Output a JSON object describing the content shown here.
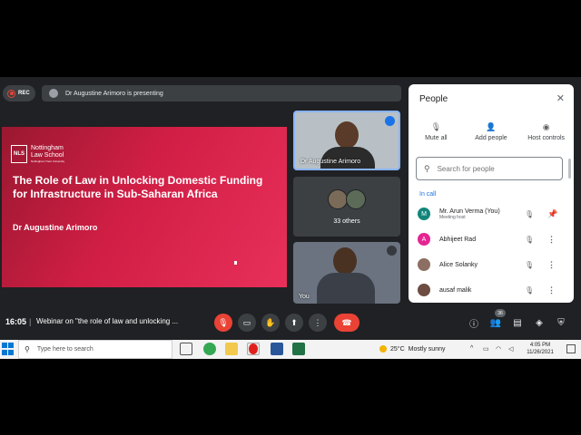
{
  "recording": {
    "label": "REC"
  },
  "presenter_banner": {
    "text": "Dr Augustine Arimoro is presenting"
  },
  "slide": {
    "org_name_line1": "Nottingham",
    "org_name_line2": "Law School",
    "org_sub": "Nottingham Trent University",
    "logo_text": "NLS",
    "title": "The Role of Law in Unlocking  Domestic Funding for Infrastructure in Sub-Saharan Africa",
    "author": "Dr Augustine Arimoro"
  },
  "tiles": {
    "presenter_name": "Dr Augustine Arimoro",
    "others_label": "33 others",
    "self_label": "You"
  },
  "people_panel": {
    "title": "People",
    "actions": [
      {
        "icon": "mic-off-icon",
        "label": "Mute all"
      },
      {
        "icon": "add-person-icon",
        "label": "Add people"
      },
      {
        "icon": "toggle-icon",
        "label": "Host controls"
      }
    ],
    "search_placeholder": "Search for people",
    "section_label": "In call",
    "participants": [
      {
        "name": "Mr. Arun Verma (You)",
        "role": "Meeting host",
        "initial": "M",
        "color": "#12867a"
      },
      {
        "name": "Abhijeet Rad",
        "role": "",
        "initial": "A",
        "color": "#e52592"
      },
      {
        "name": "Alice Solanky",
        "role": "",
        "initial": "",
        "color": "#8d6e63"
      },
      {
        "name": "ausaf malik",
        "role": "",
        "initial": "",
        "color": "#6d4c41"
      }
    ]
  },
  "controls": {
    "time": "16:05",
    "separator": "|",
    "meeting_name": "Webinar on \"the role of law and unlocking ...",
    "participant_count": "36"
  },
  "taskbar": {
    "search_placeholder": "Type here to search",
    "weather_temp": "25°C",
    "weather_desc": "Mostly sunny",
    "time": "4:05 PM",
    "date": "11/26/2021"
  }
}
